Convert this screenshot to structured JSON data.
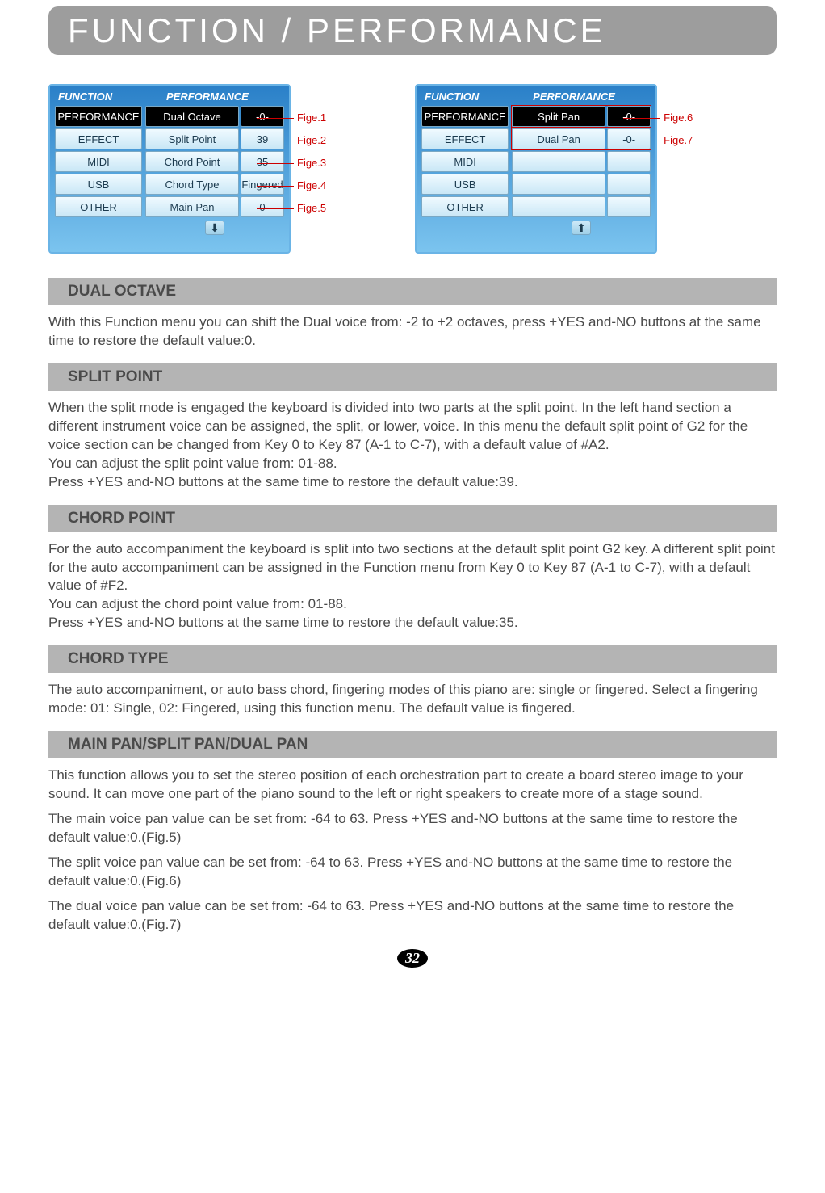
{
  "title": "FUNCTION / PERFORMANCE",
  "screenHeaders": {
    "function": "FUNCTION",
    "performance": "PERFORMANCE"
  },
  "leftMenu": [
    "PERFORMANCE",
    "EFFECT",
    "MIDI",
    "USB",
    "OTHER"
  ],
  "screen1": {
    "params": [
      {
        "name": "Dual Octave",
        "val": "-0-",
        "selected": true
      },
      {
        "name": "Split Point",
        "val": "39"
      },
      {
        "name": "Chord Point",
        "val": "35"
      },
      {
        "name": "Chord Type",
        "val": "Fingered"
      },
      {
        "name": "Main Pan",
        "val": "-0-"
      }
    ],
    "labels": [
      "Fige.1",
      "Fige.2",
      "Fige.3",
      "Fige.4",
      "Fige.5"
    ]
  },
  "screen2": {
    "params": [
      {
        "name": "Split Pan",
        "val": "-0-",
        "selected": true,
        "hl": true
      },
      {
        "name": "Dual Pan",
        "val": "-0-",
        "hl": true
      },
      {
        "name": "",
        "val": ""
      },
      {
        "name": "",
        "val": ""
      },
      {
        "name": "",
        "val": ""
      }
    ],
    "labels": [
      "Fige.6",
      "Fige.7"
    ]
  },
  "sections": {
    "dualOctave": {
      "title": "DUAL OCTAVE",
      "body": "With this Function menu you can shift the Dual voice from: -2 to +2 octaves, press +YES and-NO buttons at the same time to restore the default value:0."
    },
    "splitPoint": {
      "title": "SPLIT POINT",
      "body": "When the split mode is engaged the keyboard is divided into two parts at the split point. In the left hand section a different instrument voice can be assigned, the split, or lower, voice. In this menu the default split point of G2 for the voice section can be changed from Key 0 to Key 87 (A-1 to C-7), with a default value of #A2.\nYou can adjust the split point value from: 01-88.\nPress +YES and-NO buttons at the same time to restore the default value:39."
    },
    "chordPoint": {
      "title": "CHORD POINT",
      "body": "For the auto accompaniment the keyboard is split into two sections at the default split point G2 key. A different split point for the auto accompaniment can be assigned in the Function menu from Key 0 to Key 87 (A-1 to C-7), with a default value of #F2.\nYou can adjust the chord point value from: 01-88.\nPress +YES and-NO buttons at the same time to restore the default value:35."
    },
    "chordType": {
      "title": "CHORD TYPE",
      "body": "The auto accompaniment, or auto bass chord, fingering modes of this piano are: single or fingered. Select a fingering mode: 01: Single, 02: Fingered, using this function menu. The default value is fingered."
    },
    "pan": {
      "title": "MAIN PAN/SPLIT PAN/DUAL PAN",
      "p1": "This function allows you to set the stereo position of each orchestration part to create a board stereo image to your sound. It can move one part of the piano sound to the left or right speakers to create more of a stage sound.",
      "p2": "The main voice pan value can be set from: -64 to 63. Press +YES and-NO buttons at the same time to restore the default value:0.(Fig.5)",
      "p3": "The split voice pan value can be set from: -64 to 63. Press +YES and-NO buttons at the same time to restore the default value:0.(Fig.6)",
      "p4": "The dual voice pan value can be set from: -64 to 63. Press +YES and-NO buttons at the same time to restore the default value:0.(Fig.7)"
    }
  },
  "pageNumber": "32"
}
